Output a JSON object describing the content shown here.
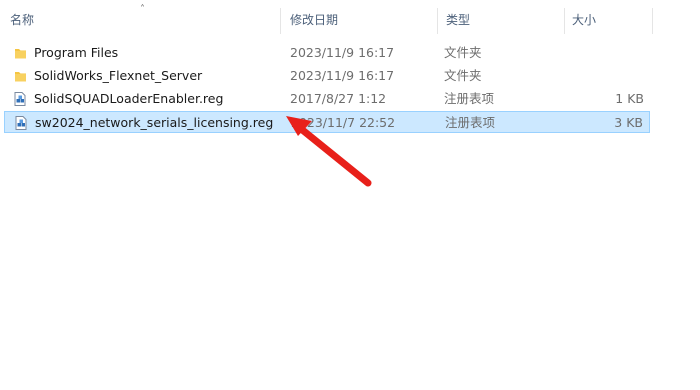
{
  "columns": {
    "name": "名称",
    "date": "修改日期",
    "type": "类型",
    "size": "大小"
  },
  "files": [
    {
      "name": "Program Files",
      "date": "2023/11/9 16:17",
      "type": "文件夹",
      "size": "",
      "icon": "folder-icon",
      "selected": false
    },
    {
      "name": "SolidWorks_Flexnet_Server",
      "date": "2023/11/9 16:17",
      "type": "文件夹",
      "size": "",
      "icon": "folder-icon",
      "selected": false
    },
    {
      "name": "SolidSQUADLoaderEnabler.reg",
      "date": "2017/8/27 1:12",
      "type": "注册表项",
      "size": "1 KB",
      "icon": "registry-file-icon",
      "selected": false
    },
    {
      "name": "sw2024_network_serials_licensing.reg",
      "date": "2023/11/7 22:52",
      "type": "注册表项",
      "size": "3 KB",
      "icon": "registry-file-icon",
      "selected": true
    }
  ],
  "colors": {
    "selection": "#cce8ff",
    "selection_border": "#99d1ff",
    "folder": "#f5c542",
    "annotation_arrow": "#e8201a"
  },
  "annotation": {
    "type": "arrow",
    "points_to": "sw2024_network_serials_licensing.reg"
  }
}
